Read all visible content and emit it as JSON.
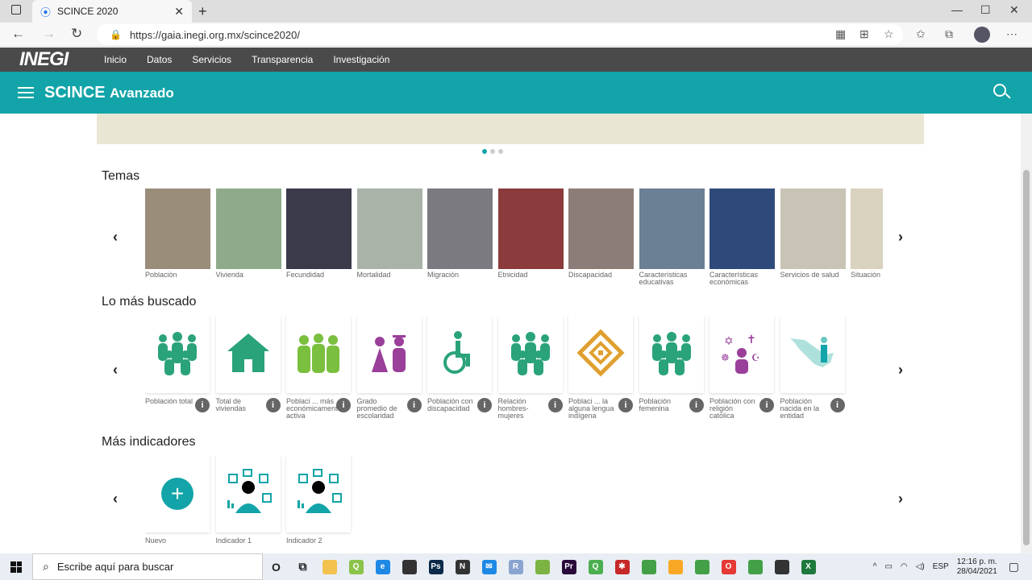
{
  "browser": {
    "tab_title": "SCINCE 2020",
    "url": "https://gaia.inegi.org.mx/scince2020/"
  },
  "inegi": {
    "logo": "INEGI",
    "menu": [
      "Inicio",
      "Datos",
      "Servicios",
      "Transparencia",
      "Investigación"
    ]
  },
  "header": {
    "title": "SCINCE",
    "subtitle": "Avanzado"
  },
  "sections": {
    "temas": {
      "title": "Temas",
      "items": [
        {
          "label": "Población",
          "color": "#9a8e7a"
        },
        {
          "label": "Vivienda",
          "color": "#8faa8a"
        },
        {
          "label": "Fecundidad",
          "color": "#3a3a4a"
        },
        {
          "label": "Mortalidad",
          "color": "#a9b3a8"
        },
        {
          "label": "Migración",
          "color": "#7a7a80"
        },
        {
          "label": "Etnicidad",
          "color": "#8b3b3b"
        },
        {
          "label": "Discapacidad",
          "color": "#8d7d78"
        },
        {
          "label": "Características educativas",
          "color": "#6b7f95"
        },
        {
          "label": "Características económicas",
          "color": "#2e4a7a"
        },
        {
          "label": "Servicios de salud",
          "color": "#c8c3b4"
        },
        {
          "label": "Situación",
          "color": "#d8d2bf"
        }
      ]
    },
    "buscado": {
      "title": "Lo más buscado",
      "items": [
        {
          "label": "Población total",
          "icon": "people-group-icon",
          "color": "#2aa37a"
        },
        {
          "label": "Total de viviendas",
          "icon": "house-icon",
          "color": "#2aa37a"
        },
        {
          "label": "Poblaci ... más económicamente activa",
          "icon": "workers-icon",
          "color": "#7bbf3e"
        },
        {
          "label": "Grado promedio de escolaridad",
          "icon": "graduate-icon",
          "color": "#9a3f9a"
        },
        {
          "label": "Población con discapacidad",
          "icon": "wheelchair-icon",
          "color": "#2aa37a"
        },
        {
          "label": "Relación hombres-mujeres",
          "icon": "people-group-icon",
          "color": "#2aa37a"
        },
        {
          "label": "Poblaci ... la alguna lengua indígena",
          "icon": "diamond-pattern-icon",
          "color": "#e0a030"
        },
        {
          "label": "Población femenina",
          "icon": "people-group-icon",
          "color": "#2aa37a"
        },
        {
          "label": "Población con religión católica",
          "icon": "religion-icon",
          "color": "#9a3f9a"
        },
        {
          "label": "Población nacida en la entidad",
          "icon": "mexico-map-icon",
          "color": "#6bc8c0"
        }
      ]
    },
    "indicadores": {
      "title": "Más indicadores",
      "items": [
        {
          "label": "Nuevo",
          "icon": "plus-icon"
        },
        {
          "label": "Indicador 1",
          "icon": "indicator-icon"
        },
        {
          "label": "Indicador 2",
          "icon": "indicator-icon"
        }
      ]
    }
  },
  "taskbar": {
    "search_placeholder": "Escribe aquí para buscar",
    "lang": "ESP",
    "time": "12:16 p. m.",
    "date": "28/04/2021",
    "apps": [
      {
        "name": "cortana-icon",
        "glyph": "O",
        "color": "#e9eef4"
      },
      {
        "name": "task-view-icon",
        "glyph": "⧉",
        "color": "#e9eef4"
      },
      {
        "name": "file-explorer-icon",
        "glyph": "",
        "color": "#f2c14e"
      },
      {
        "name": "qgis-icon",
        "glyph": "Q",
        "color": "#8bc34a"
      },
      {
        "name": "edge-icon",
        "glyph": "e",
        "color": "#1e88e5"
      },
      {
        "name": "store-icon",
        "glyph": "",
        "color": "#333"
      },
      {
        "name": "photoshop-icon",
        "glyph": "Ps",
        "color": "#0b2a4a"
      },
      {
        "name": "notion-icon",
        "glyph": "N",
        "color": "#333"
      },
      {
        "name": "mail-icon",
        "glyph": "✉",
        "color": "#1e88e5"
      },
      {
        "name": "r-icon",
        "glyph": "R",
        "color": "#8aa4d0"
      },
      {
        "name": "maps-icon",
        "glyph": "",
        "color": "#7cb342"
      },
      {
        "name": "premiere-icon",
        "glyph": "Pr",
        "color": "#2a0a3a"
      },
      {
        "name": "qgis2-icon",
        "glyph": "Q",
        "color": "#4caf50"
      },
      {
        "name": "app-red-icon",
        "glyph": "✱",
        "color": "#c62828"
      },
      {
        "name": "shield-icon",
        "glyph": "",
        "color": "#43a047"
      },
      {
        "name": "norton-icon",
        "glyph": "",
        "color": "#f9a825"
      },
      {
        "name": "chrome-icon",
        "glyph": "",
        "color": "#43a047"
      },
      {
        "name": "opera-icon",
        "glyph": "O",
        "color": "#e53935"
      },
      {
        "name": "chrome2-icon",
        "glyph": "",
        "color": "#43a047"
      },
      {
        "name": "github-icon",
        "glyph": "",
        "color": "#333"
      },
      {
        "name": "excel-icon",
        "glyph": "X",
        "color": "#1e7a3c"
      }
    ]
  }
}
